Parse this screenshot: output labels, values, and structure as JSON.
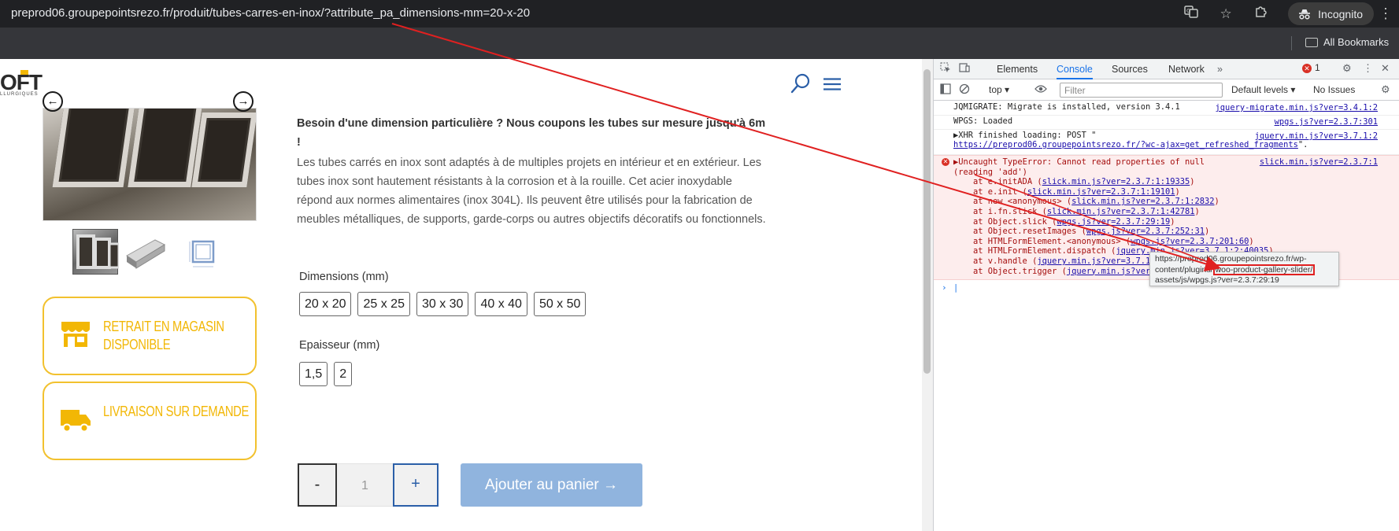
{
  "browser": {
    "url": "preprod06.groupepointsrezo.fr/produit/tubes-carres-en-inox/?attribute_pa_dimensions-mm=20-x-20",
    "incognito_label": "Incognito",
    "bookmarks_label": "All Bookmarks",
    "icons": [
      "translate-icon",
      "star-icon",
      "extensions-icon",
      "incognito-icon",
      "menu-kebab-icon",
      "folder-icon"
    ]
  },
  "site": {
    "logo_text": "OFT",
    "logo_sub": "LLURGIQUES",
    "accent_color": "#f2b705",
    "cart_button_color": "#90b4de",
    "description_strong": "Besoin d'une dimension particulière ? Nous coupons les tubes sur mesure jusqu'à 6m !",
    "description": "Les tubes carrés en inox sont adaptés à de multiples projets en intérieur et en extérieur. Les tubes inox sont hautement résistants à la corrosion et à la rouille. Cet acier inoxydable répond aux normes alimentaires (inox 304L). Ils peuvent être utilisés pour la fabrication de meubles métalliques, de supports, garde-corps ou autres objectifs décoratifs ou fonctionnels.",
    "cards": [
      {
        "label": "RETRAIT EN MAGASIN DISPONIBLE",
        "icon": "store-icon"
      },
      {
        "label": "LIVRAISON SUR DEMANDE",
        "icon": "truck-icon"
      }
    ],
    "dimensions_label": "Dimensions (mm)",
    "dimensions": [
      "20 x 20",
      "25 x 25",
      "30 x 30",
      "40 x 40",
      "50 x 50"
    ],
    "thickness_label": "Epaisseur (mm)",
    "thickness": [
      "1,5",
      "2"
    ],
    "qty_minus": "-",
    "qty_value": "1",
    "qty_plus": "+",
    "add_to_cart": "Ajouter au panier →"
  },
  "devtools": {
    "tabs": [
      "Elements",
      "Console",
      "Sources",
      "Network"
    ],
    "active_tab": "Console",
    "more_tabs": "»",
    "error_count": "1",
    "context": "top",
    "filter_placeholder": "Filter",
    "levels": "Default levels ▾",
    "issues": "No Issues",
    "logs": [
      {
        "text": "JQMIGRATE: Migrate is installed, version 3.4.1",
        "src": "jquery-migrate.min.js?ver=3.4.1:2"
      },
      {
        "text": "WPGS: Loaded",
        "src": "wpgs.js?ver=2.3.7:301"
      },
      {
        "text": "▶XHR finished loading: POST \"",
        "link": "https://preprod06.groupepointsrezo.fr/?wc-ajax=get_refreshed_fragments",
        "tail": "\".",
        "src": "jquery.min.js?ver=3.7.1:2"
      }
    ],
    "error": {
      "line1": "▶Uncaught TypeError: Cannot read properties of null",
      "line2": "(reading 'add')",
      "src": "slick.min.js?ver=2.3.7:1",
      "trace": [
        {
          "pre": "at e.initADA (",
          "link": "slick.min.js?ver=2.3.7:1:19335",
          "post": ")"
        },
        {
          "pre": "at e.init (",
          "link": "slick.min.js?ver=2.3.7:1:19101",
          "post": ")"
        },
        {
          "pre": "at new <anonymous> (",
          "link": "slick.min.js?ver=2.3.7:1:2832",
          "post": ")"
        },
        {
          "pre": "at i.fn.slick (",
          "link": "slick.min.js?ver=2.3.7:1:42781",
          "post": ")"
        },
        {
          "pre": "at Object.slick (",
          "link": "wpgs.js?ver=2.3.7:29:19",
          "post": ")"
        },
        {
          "pre": "at Object.resetImages (",
          "link": "wpgs.js?ver=2.3.7:252:31",
          "post": ")"
        },
        {
          "pre": "at HTMLFormElement.<anonymous> (",
          "link": "wpgs.js?ver=2.3.7:201:60",
          "post": ")"
        },
        {
          "pre": "at HTMLFormElement.dispatch (",
          "link": "jquery.min.js?ver=3.7.1:2:40035",
          "post": ")"
        },
        {
          "pre": "at v.handle (",
          "link": "jquery.min.js?ver=3.7.1:2:38006",
          "post": ")"
        },
        {
          "pre": "at Object.trigger (",
          "link": "jquery.min.js?ver=3.7.1:2:70124",
          "post": ")"
        }
      ]
    },
    "tooltip": {
      "line1": "https://preprod06.groupepointsrezo.fr/wp-",
      "line2_pre": "content/plugins/",
      "line2_hl": "woo-product-gallery-slider/",
      "line3": "assets/js/wpgs.js?ver=2.3.7:29:19"
    },
    "prompt": "|"
  },
  "annotation_color": "#e02020"
}
